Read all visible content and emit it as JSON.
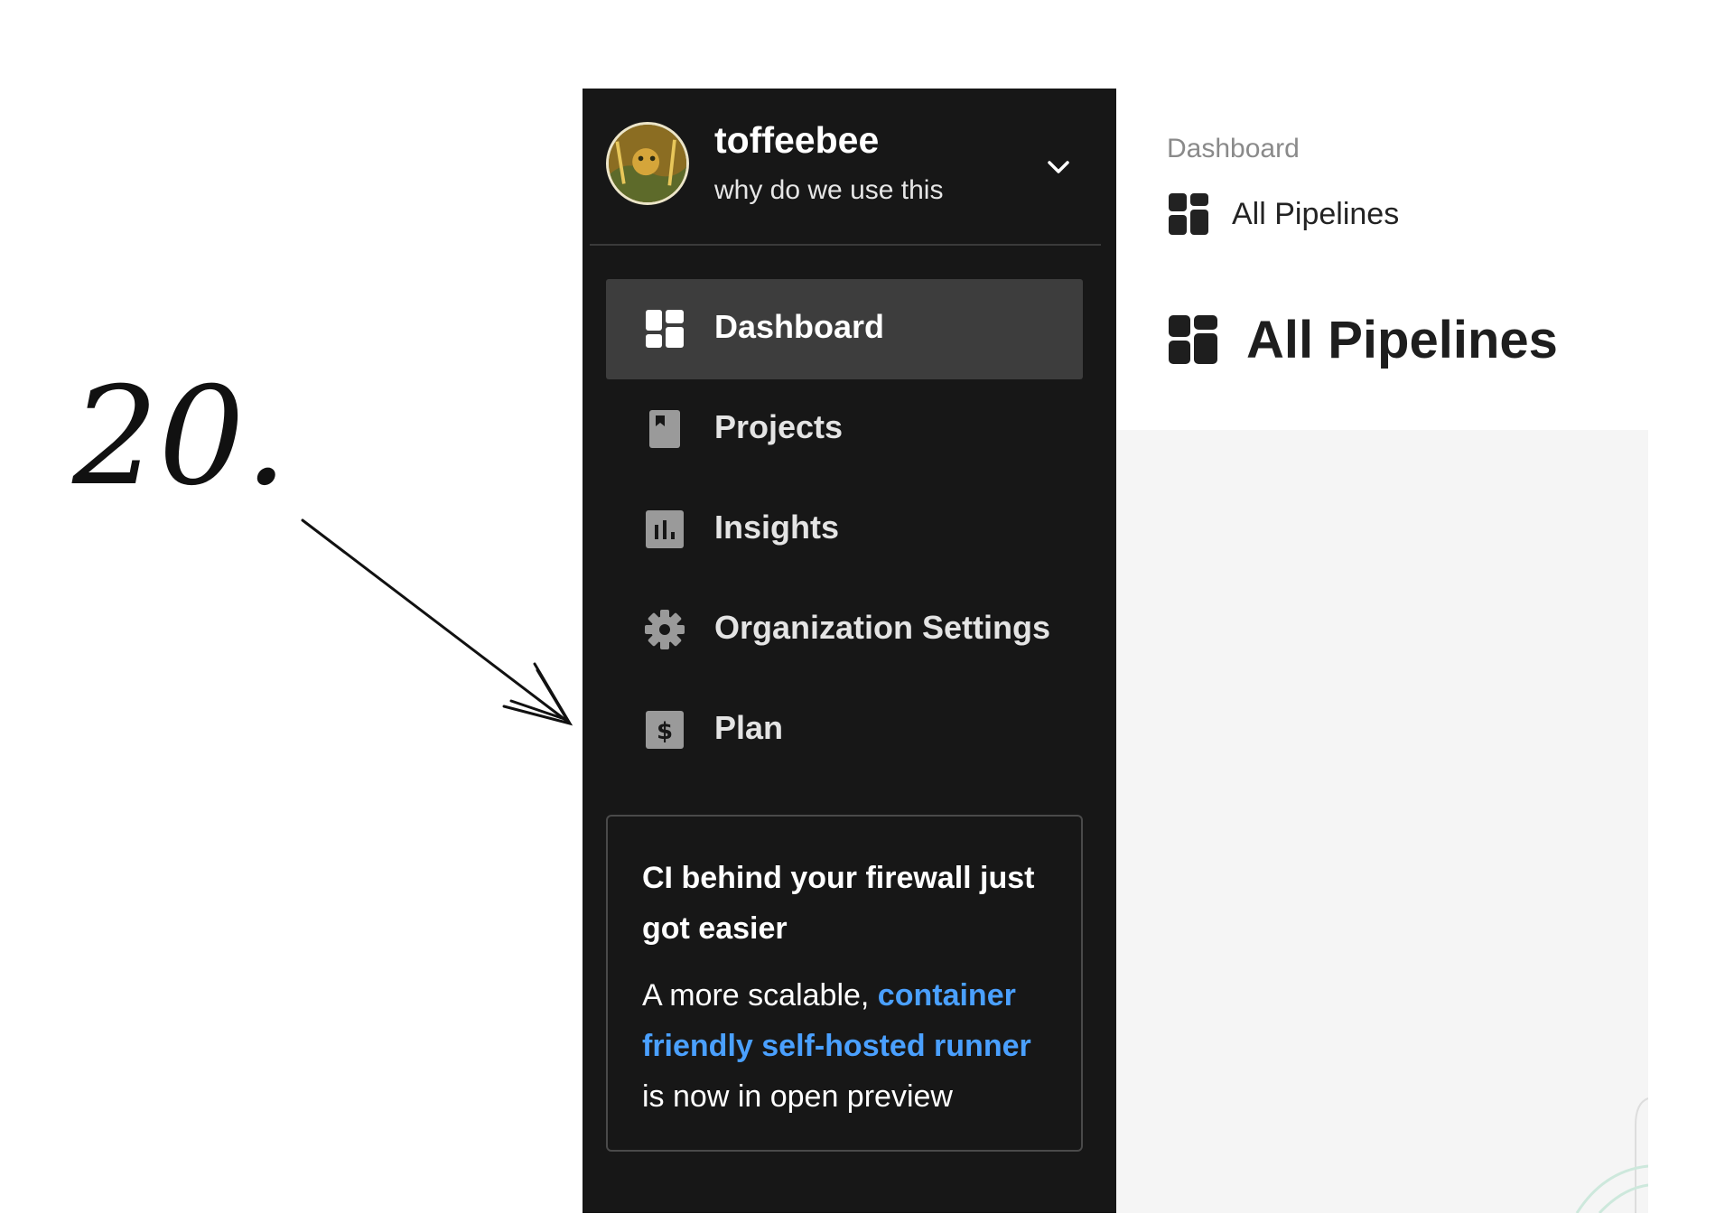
{
  "annotation": {
    "number_label": "20."
  },
  "sidebar": {
    "org": {
      "name": "toffeebee",
      "subtitle": "why do we use this"
    },
    "items": [
      {
        "label": "Dashboard",
        "icon": "dashboard-icon",
        "active": true
      },
      {
        "label": "Projects",
        "icon": "projects-icon",
        "active": false
      },
      {
        "label": "Insights",
        "icon": "insights-icon",
        "active": false
      },
      {
        "label": "Organization Settings",
        "icon": "gear-icon",
        "active": false
      },
      {
        "label": "Plan",
        "icon": "dollar-icon",
        "active": false
      }
    ],
    "promo": {
      "title": "CI behind your firewall just got easier",
      "body_before": "A more scalable, ",
      "link_text": "container friendly self-hosted runner",
      "body_after": " is now in open preview"
    }
  },
  "main": {
    "breadcrumb": "Dashboard",
    "sub_breadcrumb": "All Pipelines",
    "title": "All Pipelines"
  },
  "colors": {
    "sidebar_bg": "#171717",
    "active_item_bg": "#3d3d3d",
    "link": "#4aa0ff",
    "content_bg": "#f5f5f5"
  }
}
